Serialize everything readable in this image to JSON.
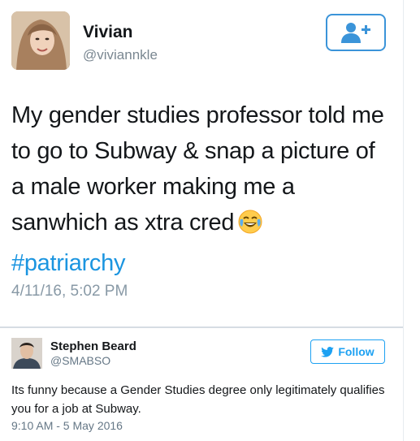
{
  "main_tweet": {
    "author_name": "Vivian",
    "author_handle": "@viviannkle",
    "follow_icon": "person-plus-icon",
    "text_before_emoji": "My gender studies professor told me to go to Subway & snap a picture of a male worker making me a sanwhich as xtra cred",
    "emoji": "face-with-tears-of-joy",
    "hashtag": "#patriarchy",
    "timestamp": "4/11/16, 5:02 PM"
  },
  "reply_tweet": {
    "author_name": "Stephen Beard",
    "author_handle": "@SMABSO",
    "follow_label": "Follow",
    "follow_icon": "twitter-bird-icon",
    "text": "Its funny because a Gender Studies degree only legitimately qualifies you for a job at Subway.",
    "timestamp": "9:10 AM - 5 May 2016"
  },
  "colors": {
    "accent": "#1da1f2",
    "hashtag": "#1b95e0",
    "text": "#14171a",
    "muted": "#8899a6"
  }
}
